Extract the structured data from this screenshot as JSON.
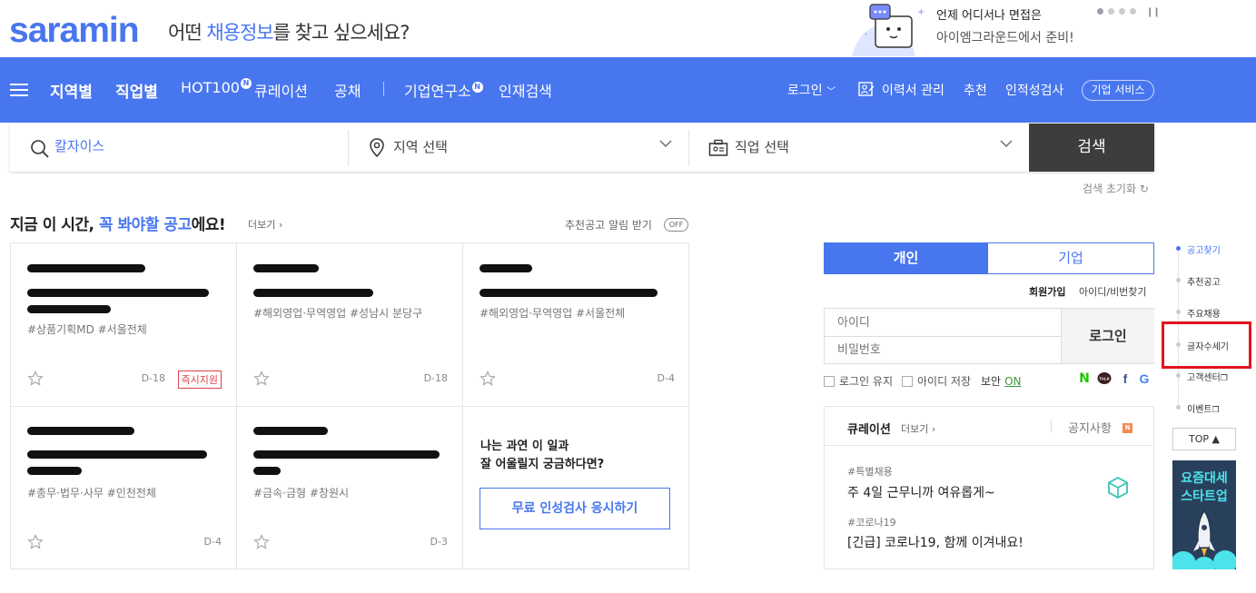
{
  "header": {
    "logo": "saramin",
    "tagline_pre": "어떤 ",
    "tagline_highlight": "채용정보",
    "tagline_post": "를 찾고 싶으세요?",
    "promo_line1": "언제 어디서나 면접은",
    "promo_line2": "아이엠그라운드에서 준비!"
  },
  "nav": {
    "items": [
      {
        "label": "지역별"
      },
      {
        "label": "직업별"
      },
      {
        "label": "HOT100"
      },
      {
        "label": "큐레이션"
      },
      {
        "label": "공채"
      },
      {
        "label": "기업연구소"
      },
      {
        "label": "인재검색"
      }
    ],
    "badge": "N",
    "login": "로그인",
    "resume": "이력서 관리",
    "recommend": "추천",
    "aptitude": "인적성검사",
    "corp_service": "기업 서비스"
  },
  "search": {
    "value": "칼자이스",
    "region_placeholder": "지역 선택",
    "job_placeholder": "직업 선택",
    "button": "검색",
    "reset": "검색 초기화"
  },
  "section": {
    "title_pre": "지금 이 시간, ",
    "title_highlight": "꼭 봐야할 공고",
    "title_post": "에요!",
    "more": "더보기 ›",
    "alert_label": "추천공고 알림 받기",
    "alert_toggle": "OFF"
  },
  "cards": [
    {
      "tags": "#상품기획MD #서울전체",
      "dday": "D-18",
      "instant": "즉시지원"
    },
    {
      "tags": "#해외영업·무역영업 #성남시 분당구",
      "dday": "D-18"
    },
    {
      "tags": "#해외영업·무역영업 #서울전체",
      "dday": "D-4"
    },
    {
      "tags": "#총무·법무·사무 #인천전체",
      "dday": "D-4"
    },
    {
      "tags": "#금속·금형 #창원시",
      "dday": "D-3"
    }
  ],
  "cta": {
    "q1": "나는 과연 이 일과",
    "q2": "잘 어울릴지 궁금하다면?",
    "button": "무료 인성검사 응시하기"
  },
  "login": {
    "tab_person": "개인",
    "tab_company": "기업",
    "join": "회원가입",
    "find": "아이디/비번찾기",
    "id_placeholder": "아이디",
    "pw_placeholder": "비밀번호",
    "button": "로그인",
    "keep": "로그인 유지",
    "save_id": "아이디 저장",
    "security": "보안",
    "security_state": "ON"
  },
  "curation": {
    "title": "큐레이션",
    "more": "더보기 ›",
    "notice": "공지사항",
    "notice_badge": "N",
    "items": [
      {
        "tag": "#특별채용",
        "title": "주 4일 근무니까 여유롭게~"
      },
      {
        "tag": "#코로나19",
        "title": "[긴급] 코로나19, 함께 이겨내요!"
      }
    ]
  },
  "rail": {
    "items": [
      "공고찾기",
      "추천공고",
      "주요채용",
      "글자수세기",
      "고객센터",
      "이벤트"
    ],
    "top": "TOP ▲",
    "banner_line1": "요즘대세",
    "banner_line2": "스타트업"
  },
  "colors": {
    "brand": "#4876EF",
    "dark_button": "#3D3D3D",
    "highlight": "#E0141E"
  }
}
